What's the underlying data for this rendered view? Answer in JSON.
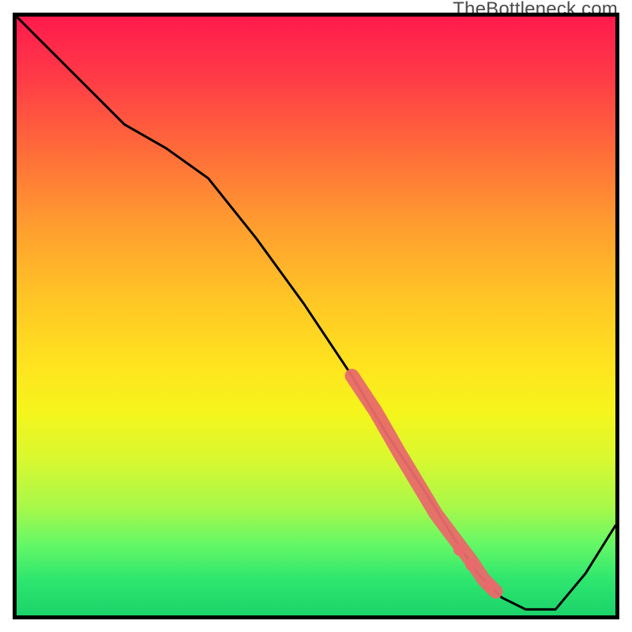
{
  "watermark": "TheBottleneck.com",
  "chart_data": {
    "type": "line",
    "title": "",
    "xlabel": "",
    "ylabel": "",
    "xlim": [
      0,
      100
    ],
    "ylim": [
      0,
      100
    ],
    "series": [
      {
        "name": "bottleneck-curve",
        "x": [
          0,
          5,
          12,
          18,
          25,
          32,
          40,
          48,
          56,
          62,
          68,
          73,
          77,
          81,
          85,
          90,
          95,
          100
        ],
        "y": [
          100,
          95,
          88,
          82,
          78,
          73,
          63,
          52,
          40,
          30,
          21,
          13,
          7,
          3,
          1,
          1,
          7,
          15
        ]
      }
    ],
    "highlight_segment": {
      "name": "salmon-band",
      "x": [
        56,
        60,
        64,
        67,
        70,
        73,
        76,
        78,
        80
      ],
      "y": [
        40,
        34,
        27,
        22,
        17,
        13,
        9,
        6,
        4
      ]
    },
    "highlight_dots": {
      "name": "salmon-dots",
      "points": [
        {
          "x": 74,
          "y": 11
        },
        {
          "x": 76,
          "y": 8.5
        },
        {
          "x": 79,
          "y": 5
        }
      ]
    },
    "colors": {
      "curve": "#000000",
      "highlight": "#e86a6a",
      "border": "#000000"
    }
  }
}
